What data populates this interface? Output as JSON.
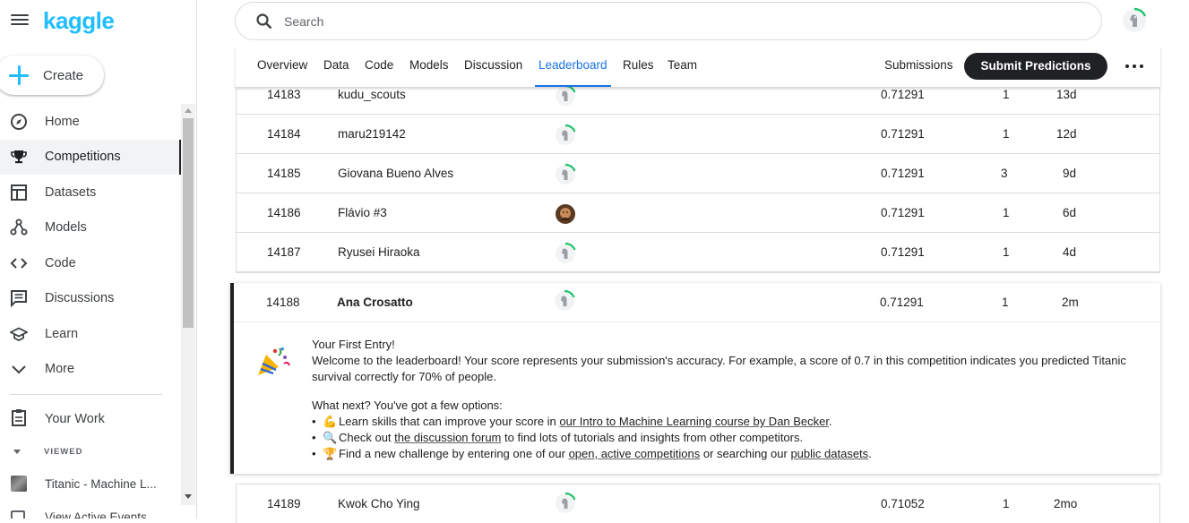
{
  "app": {
    "logo": "kaggle",
    "create_label": "Create"
  },
  "sidebar": {
    "items": [
      {
        "label": "Home",
        "icon": "compass-icon"
      },
      {
        "label": "Competitions",
        "icon": "trophy-icon",
        "active": true
      },
      {
        "label": "Datasets",
        "icon": "table-icon"
      },
      {
        "label": "Models",
        "icon": "models-icon"
      },
      {
        "label": "Code",
        "icon": "code-icon"
      },
      {
        "label": "Discussions",
        "icon": "discussion-icon"
      },
      {
        "label": "Learn",
        "icon": "school-icon"
      },
      {
        "label": "More",
        "icon": "chevron-down-icon"
      }
    ],
    "your_work": "Your Work",
    "viewed_label": "VIEWED",
    "recent": [
      "Titanic - Machine L...",
      "View Active Events"
    ]
  },
  "search": {
    "placeholder": "Search",
    "value": ""
  },
  "tabs": [
    "Overview",
    "Data",
    "Code",
    "Models",
    "Discussion",
    "Leaderboard",
    "Rules",
    "Team"
  ],
  "active_tab": "Leaderboard",
  "actions": {
    "submissions": "Submissions",
    "submit": "Submit Predictions"
  },
  "leaderboard": {
    "rows": [
      {
        "rank": "14183",
        "team": "kudu_scouts",
        "score": "0.71291",
        "entries": "1",
        "last": "13d"
      },
      {
        "rank": "14184",
        "team": "maru219142",
        "score": "0.71291",
        "entries": "1",
        "last": "12d"
      },
      {
        "rank": "14185",
        "team": "Giovana Bueno Alves",
        "score": "0.71291",
        "entries": "3",
        "last": "9d"
      },
      {
        "rank": "14186",
        "team": "Flávio #3",
        "score": "0.71291",
        "entries": "1",
        "last": "6d"
      },
      {
        "rank": "14187",
        "team": "Ryusei Hiraoka",
        "score": "0.71291",
        "entries": "1",
        "last": "4d"
      }
    ],
    "highlight": {
      "rank": "14188",
      "team": "Ana Crosatto",
      "score": "0.71291",
      "entries": "1",
      "last": "2m"
    },
    "next": {
      "rank": "14189",
      "team": "Kwok Cho Ying",
      "score": "0.71052",
      "entries": "1",
      "last": "2mo"
    }
  },
  "first_entry": {
    "title": "Your First Entry!",
    "body": "Welcome to the leaderboard! Your score represents your submission's accuracy. For example, a score of 0.7 in this competition indicates you predicted Titanic survival correctly for 70% of people.",
    "next_heading": "What next? You've got a few options:",
    "b1_emoji": "💪",
    "b1_pre": "Learn skills that can improve your score in ",
    "b1_link": "our Intro to Machine Learning course by Dan Becker",
    "b1_post": ".",
    "b2_emoji": "🔍",
    "b2_pre": "Check out ",
    "b2_link": "the discussion forum",
    "b2_post": " to find lots of tutorials and insights from other competitors.",
    "b3_emoji": "🏆",
    "b3_pre": "Find a new challenge by entering one of our ",
    "b3_link": "open, active competitions",
    "b3_mid": " or searching our ",
    "b3_link2": "public datasets",
    "b3_post": "."
  }
}
